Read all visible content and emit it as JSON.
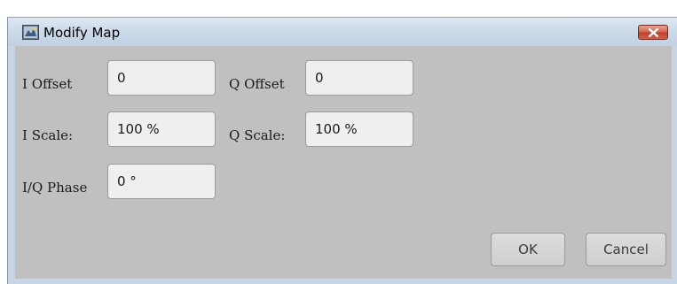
{
  "window": {
    "title": "Modify Map",
    "icon": "map-app-icon",
    "close_icon": "close-icon"
  },
  "fields": {
    "i_offset": {
      "label": "I Offset",
      "value": "0"
    },
    "q_offset": {
      "label": "Q Offset",
      "value": "0"
    },
    "i_scale": {
      "label": "I Scale:",
      "value": "100 %"
    },
    "q_scale": {
      "label": "Q Scale:",
      "value": "100 %"
    },
    "iq_phase": {
      "label": "I/Q Phase",
      "value": "0 °"
    }
  },
  "buttons": {
    "ok": "OK",
    "cancel": "Cancel"
  },
  "colors": {
    "dialog_body": "#c0c0c0",
    "close_button": "#c84a32"
  }
}
